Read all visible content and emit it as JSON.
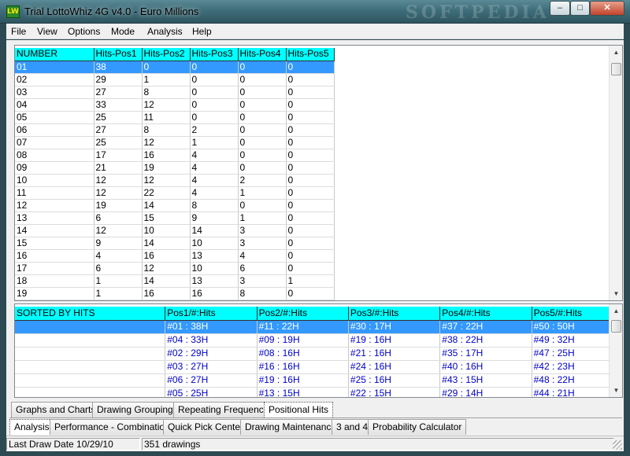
{
  "window": {
    "title": "Trial LottoWhiz 4G v4.0 - Euro Millions",
    "icon_text": "LW",
    "watermark": "SOFTPEDIA",
    "controls": {
      "minimize": "‒",
      "maximize": "□",
      "close": "✕"
    }
  },
  "menu": [
    "File",
    "View",
    "Options",
    "Mode",
    "Analysis",
    "Help"
  ],
  "grid_top": {
    "headers": [
      "NUMBER",
      "Hits-Pos1",
      "Hits-Pos2",
      "Hits-Pos3",
      "Hits-Pos4",
      "Hits-Pos5"
    ],
    "selected_row": 0,
    "rows": [
      [
        "01",
        "38",
        "0",
        "0",
        "0",
        "0"
      ],
      [
        "02",
        "29",
        "1",
        "0",
        "0",
        "0"
      ],
      [
        "03",
        "27",
        "8",
        "0",
        "0",
        "0"
      ],
      [
        "04",
        "33",
        "12",
        "0",
        "0",
        "0"
      ],
      [
        "05",
        "25",
        "11",
        "0",
        "0",
        "0"
      ],
      [
        "06",
        "27",
        "8",
        "2",
        "0",
        "0"
      ],
      [
        "07",
        "25",
        "12",
        "1",
        "0",
        "0"
      ],
      [
        "08",
        "17",
        "16",
        "4",
        "0",
        "0"
      ],
      [
        "09",
        "21",
        "19",
        "4",
        "0",
        "0"
      ],
      [
        "10",
        "12",
        "12",
        "4",
        "2",
        "0"
      ],
      [
        "11",
        "12",
        "22",
        "4",
        "1",
        "0"
      ],
      [
        "12",
        "19",
        "14",
        "8",
        "0",
        "0"
      ],
      [
        "13",
        "6",
        "15",
        "9",
        "1",
        "0"
      ],
      [
        "14",
        "12",
        "10",
        "14",
        "3",
        "0"
      ],
      [
        "15",
        "9",
        "14",
        "10",
        "3",
        "0"
      ],
      [
        "16",
        "4",
        "16",
        "13",
        "4",
        "0"
      ],
      [
        "17",
        "6",
        "12",
        "10",
        "6",
        "0"
      ],
      [
        "18",
        "1",
        "14",
        "13",
        "3",
        "1"
      ],
      [
        "19",
        "1",
        "16",
        "16",
        "8",
        "0"
      ]
    ]
  },
  "grid_bottom": {
    "headers": [
      "SORTED BY HITS",
      "Pos1/#:Hits",
      "Pos2/#:Hits",
      "Pos3/#:Hits",
      "Pos4/#:Hits",
      "Pos5/#:Hits"
    ],
    "selected_row": 0,
    "rows": [
      [
        "",
        "#01 : 38H",
        "#11 : 22H",
        "#30 : 17H",
        "#37 : 22H",
        "#50 : 50H"
      ],
      [
        "",
        "#04 : 33H",
        "#09 : 19H",
        "#19 : 16H",
        "#38 : 22H",
        "#49 : 32H"
      ],
      [
        "",
        "#02 : 29H",
        "#08 : 16H",
        "#21 : 16H",
        "#35 : 17H",
        "#47 : 25H"
      ],
      [
        "",
        "#03 : 27H",
        "#16 : 16H",
        "#24 : 16H",
        "#40 : 16H",
        "#42 : 23H"
      ],
      [
        "",
        "#06 : 27H",
        "#19 : 16H",
        "#25 : 16H",
        "#43 : 15H",
        "#48 : 22H"
      ],
      [
        "",
        "#05 : 25H",
        "#13 : 15H",
        "#22 : 15H",
        "#29 : 14H",
        "#44 : 21H"
      ]
    ]
  },
  "tabs_upper": [
    "Graphs and Charts",
    "Drawing Groupings",
    "Repeating Frequency",
    "Positional Hits"
  ],
  "tabs_upper_active": "Positional Hits",
  "tabs_lower": [
    "Analysis",
    "Performance - Combinations",
    "Quick Pick Center",
    "Drawing Maintenance",
    "3 and 4",
    "Probability Calculator"
  ],
  "tabs_lower_active": "Analysis",
  "status": {
    "last_draw": "Last Draw Date 10/29/10",
    "drawings": "351 drawings"
  },
  "colors": {
    "header_bg": "#00ffff",
    "selection_bg": "#3399ff",
    "sorted_text": "#0000cc"
  }
}
